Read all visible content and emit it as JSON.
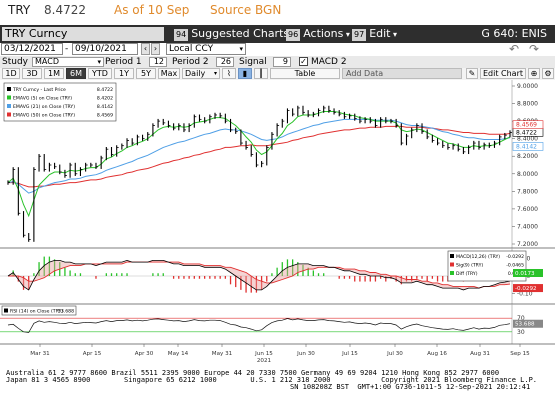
{
  "header": {
    "symbol": "TRY",
    "price": "8.4722",
    "as_of": "As of 10 Sep",
    "source": "Source BGN"
  },
  "command": {
    "security": "TRY Curncy",
    "suggested_key": "94",
    "suggested_label": "Suggested Charts",
    "actions_key": "96",
    "actions_label": "Actions",
    "edit_key": "97",
    "edit_label": "Edit",
    "page_id": "G 640: ENIS"
  },
  "dates": {
    "start": "03/12/2021",
    "end": "09/10/2021",
    "currency": "Local CCY"
  },
  "study": {
    "label": "Study",
    "name": "MACD",
    "period1_label": "Period 1",
    "period1": "12",
    "period2_label": "Period 2",
    "period2": "26",
    "signal_label": "Signal",
    "signal": "9",
    "macd2_label": "MACD 2"
  },
  "ranges": {
    "buttons": [
      "1D",
      "3D",
      "1M",
      "6M",
      "YTD",
      "1Y",
      "5Y",
      "Max"
    ],
    "active": "6M",
    "frequency": "Daily",
    "table_label": "Table",
    "add_data": "Add Data",
    "edit_chart": "Edit Chart"
  },
  "colors": {
    "price": "#000000",
    "ema5": "#29c229",
    "ema21": "#4f9fe6",
    "ema50": "#e03030",
    "macd_pos": "#29c229",
    "macd_neg": "#e03030",
    "accent": "#e08a2c"
  },
  "chart_data": [
    {
      "type": "line",
      "panel": "price",
      "legend": [
        {
          "name": "TRY Curncy - Last Price",
          "value": "8.4722",
          "color": "#000000"
        },
        {
          "name": "EMAVG (5)  on Close (TRY)",
          "value": "8.4202",
          "color": "#29c229"
        },
        {
          "name": "EMAVG (21)  on Close (TRY)",
          "value": "8.4142",
          "color": "#4f9fe6"
        },
        {
          "name": "EMAVG (50)  on Close (TRY)",
          "value": "8.4569",
          "color": "#e03030"
        }
      ],
      "yticks": [
        "9.0000",
        "8.8000",
        "8.6000",
        "8.4000",
        "8.2000",
        "8.0000",
        "7.8000",
        "7.6000",
        "7.4000",
        "7.2000"
      ],
      "ylim": [
        7.2,
        9.0
      ],
      "xticks": [
        "Mar 31",
        "Apr 15",
        "Apr 30",
        "May 14",
        "May 31",
        "Jun 15",
        "Jun 30",
        "Jul 15",
        "Jul 30",
        "Aug 16",
        "Aug 31",
        "Sep 15"
      ],
      "xtick_year": "2021",
      "last_labels": [
        {
          "text": "8.4722",
          "color": "#000000"
        },
        {
          "text": "8.4142",
          "color": "#4f9fe6"
        },
        {
          "text": "8.4569",
          "color": "#e03030"
        }
      ],
      "price": [
        7.9,
        8.05,
        7.55,
        7.3,
        7.25,
        8.05,
        8.2,
        8.05,
        8.1,
        8.08,
        8.02,
        7.98,
        8.1,
        8.0,
        8.05,
        8.1,
        8.1,
        8.08,
        8.18,
        8.28,
        8.22,
        8.3,
        8.32,
        8.38,
        8.35,
        8.42,
        8.4,
        8.45,
        8.55,
        8.6,
        8.58,
        8.55,
        8.52,
        8.55,
        8.5,
        8.55,
        8.65,
        8.62,
        8.6,
        8.65,
        8.67,
        8.66,
        8.6,
        8.5,
        8.48,
        8.35,
        8.3,
        8.22,
        8.1,
        8.12,
        8.3,
        8.45,
        8.55,
        8.6,
        8.72,
        8.68,
        8.75,
        8.7,
        8.67,
        8.68,
        8.72,
        8.75,
        8.72,
        8.7,
        8.68,
        8.65,
        8.66,
        8.63,
        8.6,
        8.62,
        8.6,
        8.55,
        8.62,
        8.6,
        8.6,
        8.55,
        8.35,
        8.43,
        8.5,
        8.55,
        8.48,
        8.42,
        8.38,
        8.35,
        8.32,
        8.3,
        8.32,
        8.28,
        8.25,
        8.3,
        8.35,
        8.3,
        8.33,
        8.32,
        8.35,
        8.42,
        8.44,
        8.47
      ],
      "ema5": [
        7.9,
        7.95,
        7.82,
        7.65,
        7.52,
        7.7,
        7.87,
        7.93,
        7.99,
        8.02,
        8.02,
        8.01,
        8.04,
        8.03,
        8.04,
        8.06,
        8.07,
        8.07,
        8.11,
        8.17,
        8.19,
        8.23,
        8.26,
        8.3,
        8.32,
        8.35,
        8.37,
        8.4,
        8.45,
        8.5,
        8.53,
        8.54,
        8.53,
        8.54,
        8.53,
        8.54,
        8.58,
        8.59,
        8.6,
        8.62,
        8.64,
        8.64,
        8.63,
        8.59,
        8.55,
        8.49,
        8.42,
        8.36,
        8.27,
        8.22,
        8.25,
        8.32,
        8.4,
        8.46,
        8.55,
        8.59,
        8.65,
        8.67,
        8.67,
        8.67,
        8.69,
        8.71,
        8.71,
        8.71,
        8.7,
        8.68,
        8.67,
        8.66,
        8.64,
        8.63,
        8.62,
        8.6,
        8.6,
        8.6,
        8.6,
        8.58,
        8.5,
        8.48,
        8.49,
        8.51,
        8.5,
        8.47,
        8.44,
        8.41,
        8.38,
        8.35,
        8.34,
        8.32,
        8.3,
        8.3,
        8.32,
        8.31,
        8.32,
        8.32,
        8.33,
        8.36,
        8.39,
        8.42
      ],
      "ema21": [
        7.9,
        7.91,
        7.88,
        7.83,
        7.78,
        7.8,
        7.84,
        7.86,
        7.88,
        7.9,
        7.91,
        7.92,
        7.94,
        7.94,
        7.95,
        7.97,
        7.98,
        7.99,
        8.01,
        8.04,
        8.06,
        8.08,
        8.1,
        8.12,
        8.14,
        8.17,
        8.19,
        8.21,
        8.24,
        8.27,
        8.3,
        8.32,
        8.34,
        8.36,
        8.37,
        8.39,
        8.41,
        8.43,
        8.45,
        8.46,
        8.48,
        8.5,
        8.51,
        8.5,
        8.5,
        8.49,
        8.47,
        8.45,
        8.42,
        8.39,
        8.38,
        8.39,
        8.4,
        8.42,
        8.45,
        8.47,
        8.49,
        8.51,
        8.53,
        8.55,
        8.56,
        8.58,
        8.59,
        8.6,
        8.61,
        8.62,
        8.62,
        8.62,
        8.62,
        8.62,
        8.62,
        8.61,
        8.61,
        8.61,
        8.61,
        8.6,
        8.58,
        8.56,
        8.55,
        8.55,
        8.54,
        8.53,
        8.52,
        8.5,
        8.48,
        8.47,
        8.45,
        8.44,
        8.42,
        8.41,
        8.41,
        8.4,
        8.39,
        8.39,
        8.39,
        8.39,
        8.4,
        8.41
      ],
      "ema50": [
        7.9,
        7.9,
        7.89,
        7.87,
        7.85,
        7.85,
        7.86,
        7.86,
        7.87,
        7.88,
        7.88,
        7.89,
        7.9,
        7.9,
        7.91,
        7.92,
        7.93,
        7.93,
        7.94,
        7.96,
        7.97,
        7.98,
        7.99,
        8.01,
        8.02,
        8.04,
        8.05,
        8.06,
        8.08,
        8.1,
        8.12,
        8.13,
        8.15,
        8.16,
        8.18,
        8.19,
        8.21,
        8.22,
        8.24,
        8.25,
        8.27,
        8.28,
        8.3,
        8.3,
        8.31,
        8.32,
        8.32,
        8.33,
        8.32,
        8.32,
        8.32,
        8.33,
        8.34,
        8.35,
        8.36,
        8.38,
        8.39,
        8.41,
        8.42,
        8.43,
        8.45,
        8.46,
        8.47,
        8.48,
        8.49,
        8.5,
        8.5,
        8.51,
        8.52,
        8.52,
        8.53,
        8.53,
        8.53,
        8.54,
        8.54,
        8.54,
        8.54,
        8.53,
        8.53,
        8.53,
        8.53,
        8.52,
        8.52,
        8.51,
        8.5,
        8.5,
        8.49,
        8.48,
        8.47,
        8.47,
        8.46,
        8.46,
        8.46,
        8.45,
        8.45,
        8.45,
        8.45,
        8.46
      ]
    },
    {
      "type": "line",
      "panel": "macd",
      "legend": [
        {
          "name": "MACD(12,26) (TRY)",
          "value": "-0.0292",
          "color": "#000000"
        },
        {
          "name": "Sig(9) (TRY)",
          "value": "-0.0465",
          "color": "#e03030"
        },
        {
          "name": "Diff (TRY)",
          "value": "0.0173",
          "color": "#29c229"
        }
      ],
      "yticks": [
        "0.10",
        "0.00",
        "-0.10"
      ],
      "ylim": [
        -0.15,
        0.15
      ],
      "last_labels": [
        {
          "text": "0.0173",
          "color": "#29c229"
        },
        {
          "text": "-0.0292",
          "color": "#e03030"
        }
      ],
      "macd": [
        0.0,
        0.02,
        -0.02,
        -0.06,
        -0.08,
        -0.02,
        0.03,
        0.06,
        0.08,
        0.09,
        0.09,
        0.08,
        0.08,
        0.07,
        0.07,
        0.07,
        0.07,
        0.06,
        0.07,
        0.08,
        0.08,
        0.08,
        0.08,
        0.09,
        0.08,
        0.08,
        0.08,
        0.08,
        0.09,
        0.09,
        0.09,
        0.08,
        0.07,
        0.07,
        0.06,
        0.06,
        0.06,
        0.06,
        0.05,
        0.05,
        0.05,
        0.05,
        0.04,
        0.02,
        0.0,
        -0.02,
        -0.04,
        -0.06,
        -0.08,
        -0.08,
        -0.06,
        -0.03,
        0.0,
        0.03,
        0.05,
        0.06,
        0.07,
        0.07,
        0.07,
        0.06,
        0.06,
        0.06,
        0.05,
        0.05,
        0.04,
        0.03,
        0.03,
        0.02,
        0.01,
        0.01,
        0.0,
        0.0,
        0.0,
        -0.01,
        -0.01,
        -0.02,
        -0.04,
        -0.04,
        -0.04,
        -0.03,
        -0.04,
        -0.05,
        -0.05,
        -0.06,
        -0.07,
        -0.07,
        -0.07,
        -0.07,
        -0.08,
        -0.07,
        -0.07,
        -0.07,
        -0.06,
        -0.06,
        -0.05,
        -0.04,
        -0.035,
        -0.029
      ],
      "signal": [
        0.0,
        0.0,
        0.0,
        -0.01,
        -0.03,
        -0.03,
        -0.02,
        -0.01,
        0.01,
        0.03,
        0.04,
        0.05,
        0.06,
        0.06,
        0.06,
        0.07,
        0.07,
        0.07,
        0.07,
        0.07,
        0.07,
        0.07,
        0.07,
        0.08,
        0.08,
        0.08,
        0.08,
        0.08,
        0.08,
        0.08,
        0.08,
        0.08,
        0.08,
        0.08,
        0.07,
        0.07,
        0.07,
        0.07,
        0.06,
        0.06,
        0.06,
        0.06,
        0.05,
        0.05,
        0.04,
        0.03,
        0.02,
        0.0,
        -0.02,
        -0.03,
        -0.04,
        -0.04,
        -0.03,
        -0.02,
        -0.01,
        0.0,
        0.02,
        0.03,
        0.04,
        0.04,
        0.05,
        0.05,
        0.05,
        0.05,
        0.05,
        0.04,
        0.04,
        0.04,
        0.03,
        0.03,
        0.02,
        0.02,
        0.01,
        0.01,
        0.0,
        0.0,
        -0.01,
        -0.02,
        -0.02,
        -0.02,
        -0.03,
        -0.03,
        -0.04,
        -0.04,
        -0.05,
        -0.05,
        -0.06,
        -0.06,
        -0.06,
        -0.06,
        -0.06,
        -0.07,
        -0.06,
        -0.06,
        -0.06,
        -0.05,
        -0.05,
        -0.047
      ]
    },
    {
      "type": "line",
      "panel": "rsi",
      "legend": [
        {
          "name": "RSI (14) on Close (TRY)",
          "value": "53.688",
          "color": "#000000"
        }
      ],
      "yticks": [
        "70",
        "30"
      ],
      "ylim": [
        0,
        100
      ],
      "last_labels": [
        {
          "text": "53.688",
          "color": "#555555"
        }
      ],
      "rsi": [
        50,
        52,
        40,
        30,
        28,
        55,
        62,
        58,
        60,
        58,
        55,
        54,
        58,
        54,
        56,
        58,
        57,
        56,
        60,
        63,
        60,
        63,
        63,
        65,
        62,
        64,
        62,
        64,
        67,
        68,
        66,
        64,
        62,
        63,
        60,
        62,
        66,
        63,
        62,
        64,
        64,
        63,
        58,
        52,
        50,
        44,
        42,
        38,
        33,
        36,
        48,
        57,
        62,
        64,
        69,
        65,
        68,
        65,
        63,
        63,
        65,
        66,
        63,
        62,
        60,
        58,
        59,
        56,
        54,
        56,
        54,
        50,
        56,
        54,
        54,
        50,
        38,
        45,
        50,
        53,
        48,
        45,
        42,
        40,
        38,
        37,
        39,
        36,
        34,
        38,
        42,
        38,
        41,
        40,
        43,
        49,
        51,
        53.7
      ]
    }
  ],
  "footer": {
    "line1": "Australia 61 2 9777 8600 Brazil 5511 2395 9000 Europe 44 20 7330 7500 Germany 49 69 9204 1210 Hong Kong 852 2977 6000",
    "line2": "Japan 81 3 4565 8900        Singapore 65 6212 1000        U.S. 1 212 318 2000            Copyright 2021 Bloomberg Finance L.P.",
    "line3": "SN 108208Z BST  GMT+1:00 G736-1011-5 12-Sep-2021 20:12:41"
  }
}
